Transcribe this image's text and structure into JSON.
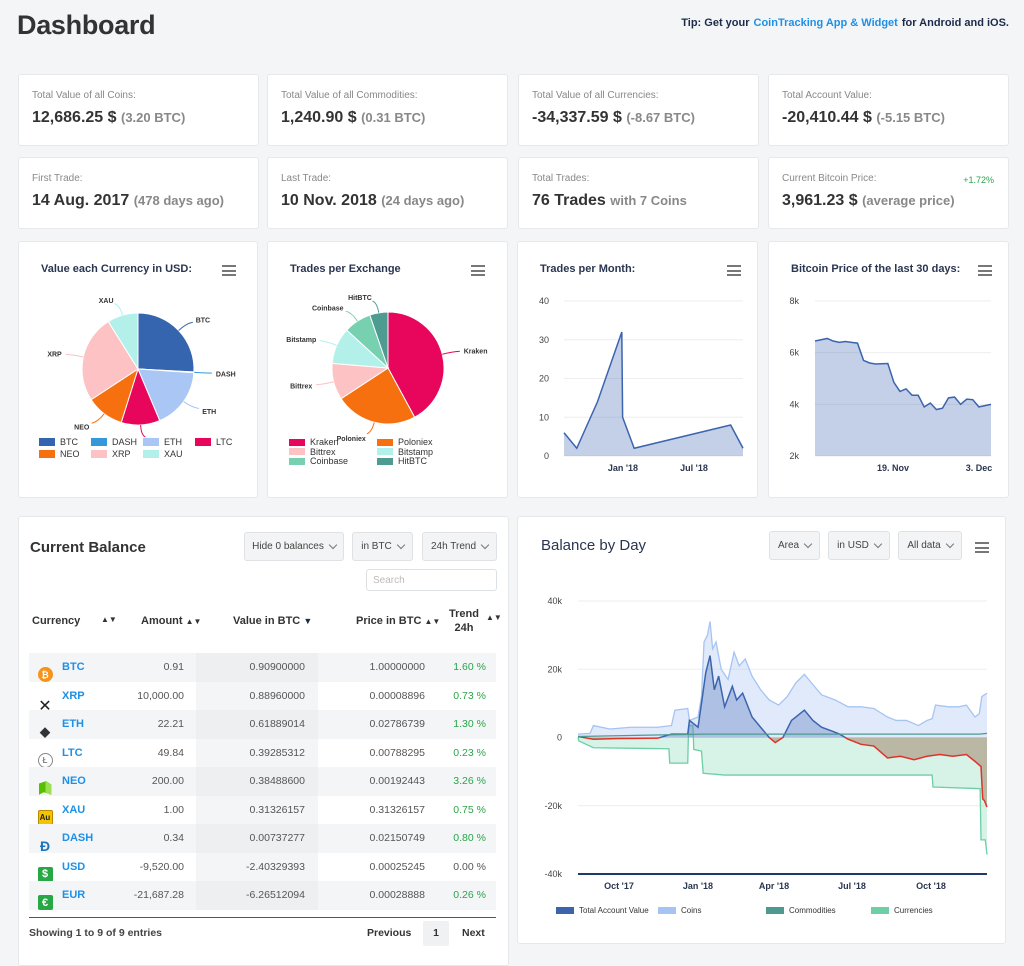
{
  "header": {
    "title": "Dashboard",
    "tip_prefix": "Tip: Get your",
    "tip_link": "CoinTracking App & Widget",
    "tip_suffix": "for Android and iOS."
  },
  "stats": [
    {
      "label": "Total Value of all Coins:",
      "value": "12,686.25 $",
      "sub": "(3.20 BTC)"
    },
    {
      "label": "Total Value of all Commodities:",
      "value": "1,240.90 $",
      "sub": "(0.31 BTC)"
    },
    {
      "label": "Total Value of all Currencies:",
      "value": "-34,337.59 $",
      "sub": "(-8.67 BTC)"
    },
    {
      "label": "Total Account Value:",
      "value": "-20,410.44 $",
      "sub": "(-5.15 BTC)"
    },
    {
      "label": "First Trade:",
      "value": "14 Aug. 2017",
      "sub": "(478 days ago)"
    },
    {
      "label": "Last Trade:",
      "value": "10 Nov. 2018",
      "sub": "(24 days ago)"
    },
    {
      "label": "Total Trades:",
      "value": "76 Trades",
      "sub": "with 7 Coins"
    },
    {
      "label": "Current Bitcoin Price:",
      "value": "3,961.23 $",
      "sub": "(average price)",
      "change": "+1.72%"
    }
  ],
  "colors": {
    "accent": "#1e90e6",
    "positive": "#2aa54a",
    "negative": "#e0322a",
    "chart_blue": "#3c64ae"
  },
  "chart_data": [
    {
      "type": "pie",
      "title": "Value each Currency in USD:",
      "slices": [
        {
          "name": "BTC",
          "value": 3600.7,
          "color": "#3565ae"
        },
        {
          "name": "DASH",
          "value": 29.2,
          "color": "#3498db"
        },
        {
          "name": "ETH",
          "value": 2451.5,
          "color": "#a9c6f5"
        },
        {
          "name": "LTC",
          "value": 1556.2,
          "color": "#e8065c"
        },
        {
          "name": "NEO",
          "value": 1524.6,
          "color": "#f7700f"
        },
        {
          "name": "XRP",
          "value": 3523.9,
          "color": "#fdc2c4"
        },
        {
          "name": "XAU",
          "value": 1240.9,
          "color": "#b4f0ea"
        }
      ]
    },
    {
      "type": "pie",
      "title": "Trades per Exchange",
      "slices": [
        {
          "name": "Kraken",
          "value": 32,
          "color": "#e8065c"
        },
        {
          "name": "Poloniex",
          "value": 18,
          "color": "#f7700f"
        },
        {
          "name": "Bittrex",
          "value": 8,
          "color": "#fdc2c4"
        },
        {
          "name": "Bitstamp",
          "value": 8,
          "color": "#b4f0ea"
        },
        {
          "name": "Coinbase",
          "value": 6,
          "color": "#77d0b0"
        },
        {
          "name": "HitBTC",
          "value": 4,
          "color": "#4e9c91"
        }
      ]
    },
    {
      "type": "area",
      "title": "Trades per Month:",
      "ylim": [
        0,
        40
      ],
      "yticks": [
        "0",
        "10",
        "20",
        "30",
        "40"
      ],
      "xticks": [
        "Jan '18",
        "Jul '18"
      ],
      "points": [
        [
          "2017-08-09",
          6
        ],
        [
          "2017-09-10",
          2
        ],
        [
          "2017-11-01",
          14
        ],
        [
          "2018-01-01",
          32
        ],
        [
          "2018-01-03",
          10
        ],
        [
          "2018-02-01",
          2
        ],
        [
          "2018-10-01",
          8
        ],
        [
          "2018-11-01",
          2
        ]
      ]
    },
    {
      "type": "area",
      "title": "Bitcoin Price of the last 30 days:",
      "ylim": [
        2000,
        8000
      ],
      "yticks": [
        "2k",
        "4k",
        "6k",
        "8k"
      ],
      "xticks": [
        "19. Nov",
        "3. Dec"
      ],
      "points": [
        [
          "2018-11-06",
          6450
        ],
        [
          "2018-11-07",
          6500
        ],
        [
          "2018-11-08",
          6550
        ],
        [
          "2018-11-09",
          6450
        ],
        [
          "2018-11-10",
          6400
        ],
        [
          "2018-11-11",
          6430
        ],
        [
          "2018-11-12",
          6400
        ],
        [
          "2018-11-13",
          6370
        ],
        [
          "2018-11-14",
          5700
        ],
        [
          "2018-11-15",
          5600
        ],
        [
          "2018-11-16",
          5560
        ],
        [
          "2018-11-17",
          5570
        ],
        [
          "2018-11-18",
          5580
        ],
        [
          "2018-11-19",
          4850
        ],
        [
          "2018-11-20",
          4500
        ],
        [
          "2018-11-21",
          4600
        ],
        [
          "2018-11-22",
          4350
        ],
        [
          "2018-11-23",
          4350
        ],
        [
          "2018-11-24",
          3900
        ],
        [
          "2018-11-25",
          4050
        ],
        [
          "2018-11-26",
          3800
        ],
        [
          "2018-11-27",
          3850
        ],
        [
          "2018-11-28",
          4250
        ],
        [
          "2018-11-29",
          4280
        ],
        [
          "2018-11-30",
          4000
        ],
        [
          "2018-12-01",
          4200
        ],
        [
          "2018-12-02",
          4180
        ],
        [
          "2018-12-03",
          3900
        ],
        [
          "2018-12-04",
          3950
        ],
        [
          "2018-12-05",
          4000
        ]
      ]
    },
    {
      "type": "area",
      "title": "Balance by Day",
      "ylim": [
        -40000,
        40000
      ],
      "yticks": [
        "-40k",
        "-20k",
        "0",
        "20k",
        "40k"
      ],
      "xticks": [
        "Oct '17",
        "Jan '18",
        "Apr '18",
        "Jul '18",
        "Oct '18"
      ],
      "series": [
        {
          "name": "Currencies",
          "color": "#6dcfa5",
          "points": [
            [
              "2017-08-14",
              0
            ],
            [
              "2017-08-15",
              -1000
            ],
            [
              "2017-09-01",
              -3000
            ],
            [
              "2017-11-28",
              -3300
            ],
            [
              "2017-11-29",
              -7500
            ],
            [
              "2017-12-20",
              -7500
            ],
            [
              "2017-12-21",
              3500
            ],
            [
              "2017-12-26",
              3500
            ],
            [
              "2017-12-27",
              -3500
            ],
            [
              "2018-01-05",
              -4000
            ],
            [
              "2018-01-07",
              -10500
            ],
            [
              "2018-02-01",
              -11000
            ],
            [
              "2018-10-01",
              -11000
            ],
            [
              "2018-10-02",
              -14500
            ],
            [
              "2018-11-26",
              -15000
            ],
            [
              "2018-11-27",
              -30000
            ],
            [
              "2018-12-02",
              -30000
            ],
            [
              "2018-12-04",
              -34300
            ]
          ]
        },
        {
          "name": "Coins",
          "color": "#a6c4f3",
          "points": [
            [
              "2017-08-14",
              1000
            ],
            [
              "2017-08-28",
              1200
            ],
            [
              "2017-09-01",
              3500
            ],
            [
              "2017-09-20",
              2500
            ],
            [
              "2017-10-15",
              3000
            ],
            [
              "2017-11-15",
              3000
            ],
            [
              "2017-12-01",
              3500
            ],
            [
              "2017-12-05",
              8000
            ],
            [
              "2017-12-20",
              8500
            ],
            [
              "2017-12-22",
              5000
            ],
            [
              "2018-01-01",
              6000
            ],
            [
              "2018-01-05",
              12000
            ],
            [
              "2018-01-08",
              28000
            ],
            [
              "2018-01-12",
              30000
            ],
            [
              "2018-01-15",
              34000
            ],
            [
              "2018-01-18",
              26000
            ],
            [
              "2018-01-22",
              28000
            ],
            [
              "2018-01-28",
              20000
            ],
            [
              "2018-02-05",
              17000
            ],
            [
              "2018-02-12",
              25000
            ],
            [
              "2018-02-18",
              21000
            ],
            [
              "2018-02-25",
              23000
            ],
            [
              "2018-03-05",
              18000
            ],
            [
              "2018-03-15",
              14000
            ],
            [
              "2018-03-25",
              11000
            ],
            [
              "2018-04-05",
              9500
            ],
            [
              "2018-04-15",
              12000
            ],
            [
              "2018-04-25",
              16000
            ],
            [
              "2018-05-05",
              18500
            ],
            [
              "2018-05-15",
              15500
            ],
            [
              "2018-05-25",
              12500
            ],
            [
              "2018-06-10",
              11000
            ],
            [
              "2018-06-25",
              9000
            ],
            [
              "2018-07-10",
              9000
            ],
            [
              "2018-07-25",
              8500
            ],
            [
              "2018-08-10",
              6000
            ],
            [
              "2018-08-20",
              5000
            ],
            [
              "2018-09-01",
              5000
            ],
            [
              "2018-09-15",
              3500
            ],
            [
              "2018-09-25",
              5000
            ],
            [
              "2018-10-01",
              5500
            ],
            [
              "2018-10-05",
              9500
            ],
            [
              "2018-10-20",
              9000
            ],
            [
              "2018-11-01",
              9000
            ],
            [
              "2018-11-10",
              9500
            ],
            [
              "2018-11-20",
              6000
            ],
            [
              "2018-11-25",
              7000
            ],
            [
              "2018-11-28",
              12000
            ],
            [
              "2018-12-04",
              13000
            ]
          ]
        },
        {
          "name": "Total Account Value",
          "color": "#3c64ae",
          "negative_color": "#e0322a",
          "points": [
            [
              "2017-08-14",
              300
            ],
            [
              "2017-09-01",
              -500
            ],
            [
              "2017-10-01",
              -300
            ],
            [
              "2017-11-15",
              -200
            ],
            [
              "2017-12-01",
              1000
            ],
            [
              "2017-12-20",
              1000
            ],
            [
              "2017-12-22",
              5000
            ],
            [
              "2018-01-01",
              3000
            ],
            [
              "2018-01-05",
              10000
            ],
            [
              "2018-01-10",
              19000
            ],
            [
              "2018-01-15",
              24000
            ],
            [
              "2018-01-20",
              14000
            ],
            [
              "2018-01-25",
              18000
            ],
            [
              "2018-02-01",
              9000
            ],
            [
              "2018-02-10",
              15000
            ],
            [
              "2018-02-15",
              11000
            ],
            [
              "2018-02-22",
              13000
            ],
            [
              "2018-03-05",
              6000
            ],
            [
              "2018-03-15",
              3000
            ],
            [
              "2018-03-25",
              0
            ],
            [
              "2018-04-01",
              -1500
            ],
            [
              "2018-04-10",
              0
            ],
            [
              "2018-04-20",
              5000
            ],
            [
              "2018-05-05",
              8000
            ],
            [
              "2018-05-15",
              5000
            ],
            [
              "2018-05-25",
              3000
            ],
            [
              "2018-06-05",
              2000
            ],
            [
              "2018-06-15",
              1000
            ],
            [
              "2018-06-25",
              -500
            ],
            [
              "2018-07-10",
              -2000
            ],
            [
              "2018-07-25",
              -2500
            ],
            [
              "2018-08-10",
              -6000
            ],
            [
              "2018-08-25",
              -5500
            ],
            [
              "2018-09-10",
              -6500
            ],
            [
              "2018-09-25",
              -5500
            ],
            [
              "2018-10-10",
              -5000
            ],
            [
              "2018-10-25",
              -5500
            ],
            [
              "2018-11-10",
              -5000
            ],
            [
              "2018-11-20",
              -7000
            ],
            [
              "2018-11-27",
              -8500
            ],
            [
              "2018-11-29",
              -18000
            ],
            [
              "2018-12-01",
              -18500
            ],
            [
              "2018-12-04",
              -20400
            ]
          ]
        },
        {
          "name": "Commodities",
          "color": "#4d9a8e",
          "points": [
            [
              "2017-08-14",
              300
            ],
            [
              "2018-01-07",
              1000
            ],
            [
              "2018-11-25",
              1000
            ],
            [
              "2018-12-04",
              1200
            ]
          ]
        }
      ]
    }
  ],
  "balance": {
    "title": "Current Balance",
    "filters": [
      "Hide 0 balances",
      "in BTC",
      "24h Trend"
    ],
    "search_placeholder": "Search",
    "columns": [
      "Currency",
      "Amount",
      "Value in BTC",
      "Price in BTC",
      "Trend",
      "24h"
    ],
    "rows": [
      {
        "currency": "BTC",
        "icon": "bitcoin-icon",
        "amount": "0.91",
        "value": "0.90900000",
        "price": "1.00000000",
        "trend": "1.60 %"
      },
      {
        "currency": "XRP",
        "icon": "ripple-icon",
        "amount": "10,000.00",
        "value": "0.88960000",
        "price": "0.00008896",
        "trend": "0.73 %"
      },
      {
        "currency": "ETH",
        "icon": "ethereum-icon",
        "amount": "22.21",
        "value": "0.61889014",
        "price": "0.02786739",
        "trend": "1.30 %"
      },
      {
        "currency": "LTC",
        "icon": "litecoin-icon",
        "amount": "49.84",
        "value": "0.39285312",
        "price": "0.00788295",
        "trend": "0.23 %"
      },
      {
        "currency": "NEO",
        "icon": "neo-icon",
        "amount": "200.00",
        "value": "0.38488600",
        "price": "0.00192443",
        "trend": "3.26 %"
      },
      {
        "currency": "XAU",
        "icon": "gold-icon",
        "amount": "1.00",
        "value": "0.31326157",
        "price": "0.31326157",
        "trend": "0.75 %"
      },
      {
        "currency": "DASH",
        "icon": "dash-icon",
        "amount": "0.34",
        "value": "0.00737277",
        "price": "0.02150749",
        "trend": "0.80 %"
      },
      {
        "currency": "USD",
        "icon": "dollar-icon",
        "amount": "-9,520.00",
        "value": "-2.40329393",
        "price": "0.00025245",
        "trend": "0.00 %"
      },
      {
        "currency": "EUR",
        "icon": "euro-icon",
        "amount": "-21,687.28",
        "value": "-6.26512094",
        "price": "0.00028888",
        "trend": "0.26 %"
      }
    ],
    "icon_glyphs": {
      "gold": "Au",
      "dollar": "$",
      "euro": "€"
    },
    "info": "Showing 1 to 9 of 9 entries",
    "pagination": {
      "previous": "Previous",
      "page": "1",
      "next": "Next"
    }
  },
  "balance_by_day": {
    "title": "Balance by Day",
    "filters": [
      "Area",
      "in USD",
      "All data"
    ]
  }
}
